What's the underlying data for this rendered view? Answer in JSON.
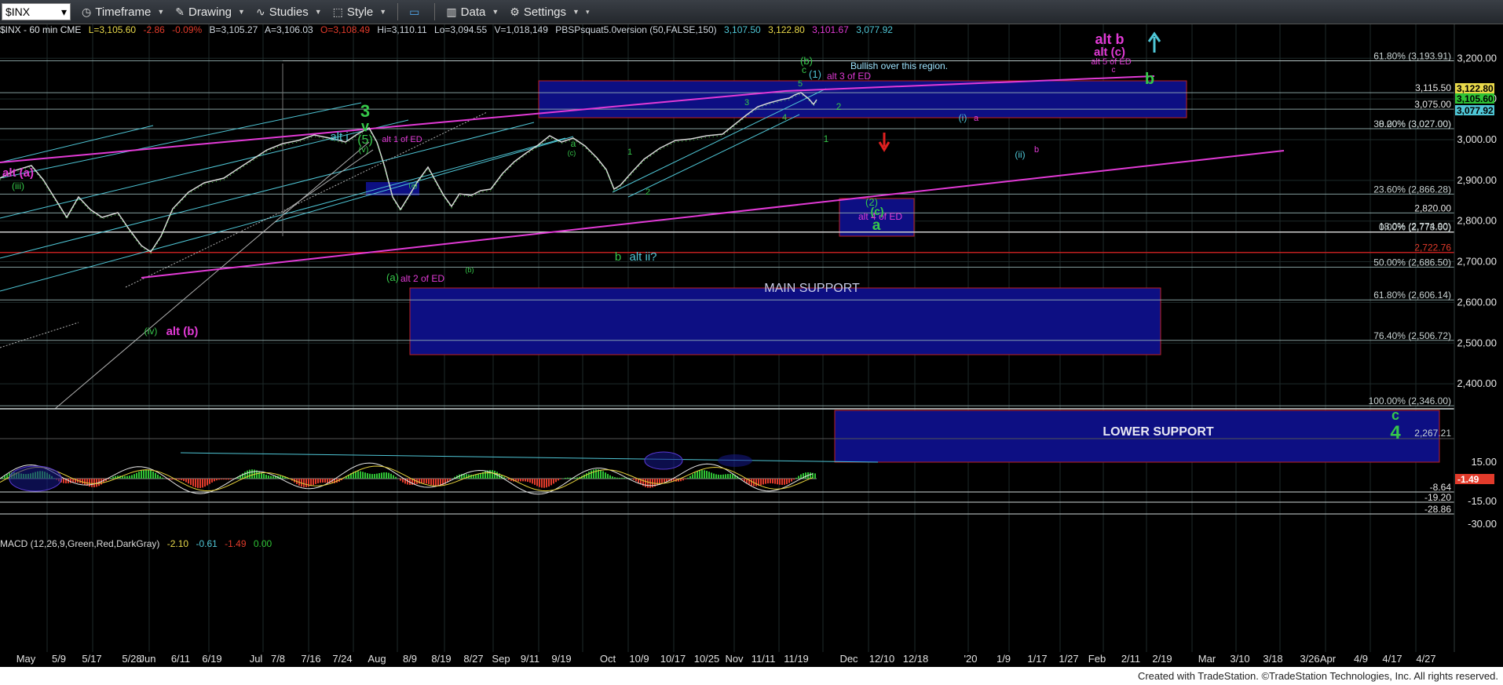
{
  "toolbar": {
    "symbol": "$INX",
    "timeframe": "Timeframe",
    "drawing": "Drawing",
    "studies": "Studies",
    "style": "Style",
    "data": "Data",
    "settings": "Settings"
  },
  "info": {
    "title": "$INX - 60 min  CME",
    "last": "L=3,105.60",
    "change": "-2.86",
    "pct": "-0.09%",
    "bid": "B=3,105.27",
    "ask": "A=3,106.03",
    "open": "O=3,108.49",
    "high": "Hi=3,110.11",
    "low": "Lo=3,094.55",
    "volume": "V=1,018,149",
    "study": "PBSPsquat5.0version (50,FALSE,150)",
    "v1": "3,107.50",
    "v2": "3,122.80",
    "v3": "3,101.67",
    "v4": "3,077.92"
  },
  "macd": {
    "label": "MACD (12,26,9,Green,Red,DarkGray)",
    "macd": "-2.10",
    "signal": "-0.61",
    "hist": "-1.49",
    "zero": "0.00"
  },
  "colors": {
    "background": "#000000",
    "grid": "#1e2a2a",
    "price": "#d8d8d8",
    "channel_teal": "#4fc6d6",
    "magenta": "#e23ad6",
    "box_fill": "#0d0f83",
    "green_label": "#36c84a",
    "hline": "#9ab6b6",
    "redline": "#c02020",
    "macd_line": "#e6e6e6",
    "signal_line": "#e6d23c",
    "hist_pos": "#2fc335",
    "hist_neg": "#e23b2b"
  },
  "price_axis": {
    "ticks": [
      "3,200.00",
      "3,100.00",
      "3,000.00",
      "2,900.00",
      "2,800.00",
      "2,700.00",
      "2,600.00",
      "2,500.00",
      "2,400.00"
    ],
    "price_tags": [
      "3,122.80",
      "3,105.60",
      "3,077.92"
    ],
    "fib_levels": [
      {
        "label": "61.80% (3,193.91)",
        "price": 3193.91
      },
      {
        "label": "38.20% (3,027.00)",
        "price": 3027
      },
      {
        "label": "0.00% (3,027.00)",
        "price": 3027
      },
      {
        "label": "23.60% (2,866.28)",
        "price": 2866.28
      },
      {
        "label": "0.00% (2,773.00)",
        "price": 2773
      },
      {
        "label": "18.0% (2,774.90)",
        "price": 2774.9
      },
      {
        "label": "50.00% (2,686.50)",
        "price": 2686.5
      },
      {
        "label": "61.80% (2,606.14)",
        "price": 2606.14
      },
      {
        "label": "76.40% (2,506.72)",
        "price": 2506.72
      },
      {
        "label": "100.00% (2,346.00)",
        "price": 2346
      },
      {
        "label": "2,267.21",
        "price": 2267.21
      }
    ],
    "levels": [
      {
        "label": "3,115.50",
        "price": 3115.5
      },
      {
        "label": "3,075.00",
        "price": 3075
      },
      {
        "label": "2,820.00",
        "price": 2820
      },
      {
        "label": "2,722.76",
        "price": 2722.76
      }
    ]
  },
  "macd_axis": {
    "ticks": [
      "15.00",
      "-15.00",
      "-30.00"
    ],
    "levels": [
      "-8.64",
      "-19.20",
      "-28.86"
    ],
    "tag": "-1.49"
  },
  "date_axis": [
    "May",
    "5/9",
    "5/17",
    "5/28",
    "Jun",
    "6/11",
    "6/19",
    "Jul",
    "7/8",
    "7/16",
    "7/24",
    "Aug",
    "8/9",
    "8/19",
    "8/27",
    "Sep",
    "9/11",
    "9/19",
    "Oct",
    "10/9",
    "10/17",
    "10/25",
    "Nov",
    "11/11",
    "11/19",
    "Dec",
    "12/10",
    "12/18",
    "'20",
    "1/9",
    "1/17",
    "1/27",
    "Feb",
    "2/11",
    "2/19",
    "Mar",
    "3/10",
    "3/18",
    "3/26",
    "Apr",
    "4/9",
    "4/17",
    "4/27"
  ],
  "boxes": {
    "bullish": "Bullish over this region.",
    "main_support": "MAIN SUPPORT",
    "lower_support": "LOWER SUPPORT"
  },
  "labels": {
    "alt_b": "alt b",
    "alt_c": "alt (c)",
    "alt_5_ed": "alt 5 of ED",
    "b_big": "b",
    "b_paren": "(b)",
    "c_small": "c",
    "one_paren": "(1)",
    "alt_3_ed": "alt 3 of ED",
    "three": "3",
    "v_big": "v",
    "five_paren": "(5)",
    "alt_i": "alt i",
    "v_paren": "(v)",
    "alt_1_ed": "alt 1 of ED",
    "alt_a_paren": "alt (a)",
    "iii_paren": "(iii)",
    "iv_paren": "(iv)",
    "alt_b_paren": "alt (b)",
    "a_paren": "(a)",
    "alt_2_ed": "alt 2 of ED",
    "b_paren2": "(b)",
    "a_small": "a",
    "c_paren_small": "(c)",
    "b_alt_ii": "b",
    "alt_ii": "alt ii?",
    "two_paren": "(2)",
    "alt_4_ed": "alt 4 of ED",
    "c_paren": "(c)",
    "a_big": "a",
    "i_paren": "(i)",
    "a_mag": "a",
    "ii_paren": "(ii)",
    "b_mag": "b",
    "n1": "1",
    "n2": "2",
    "n3": "3",
    "n4": "4",
    "n5": "5",
    "c_big": "c",
    "four_big": "4"
  },
  "footer": "Created with TradeStation. ©TradeStation Technologies, Inc. All rights reserved."
}
